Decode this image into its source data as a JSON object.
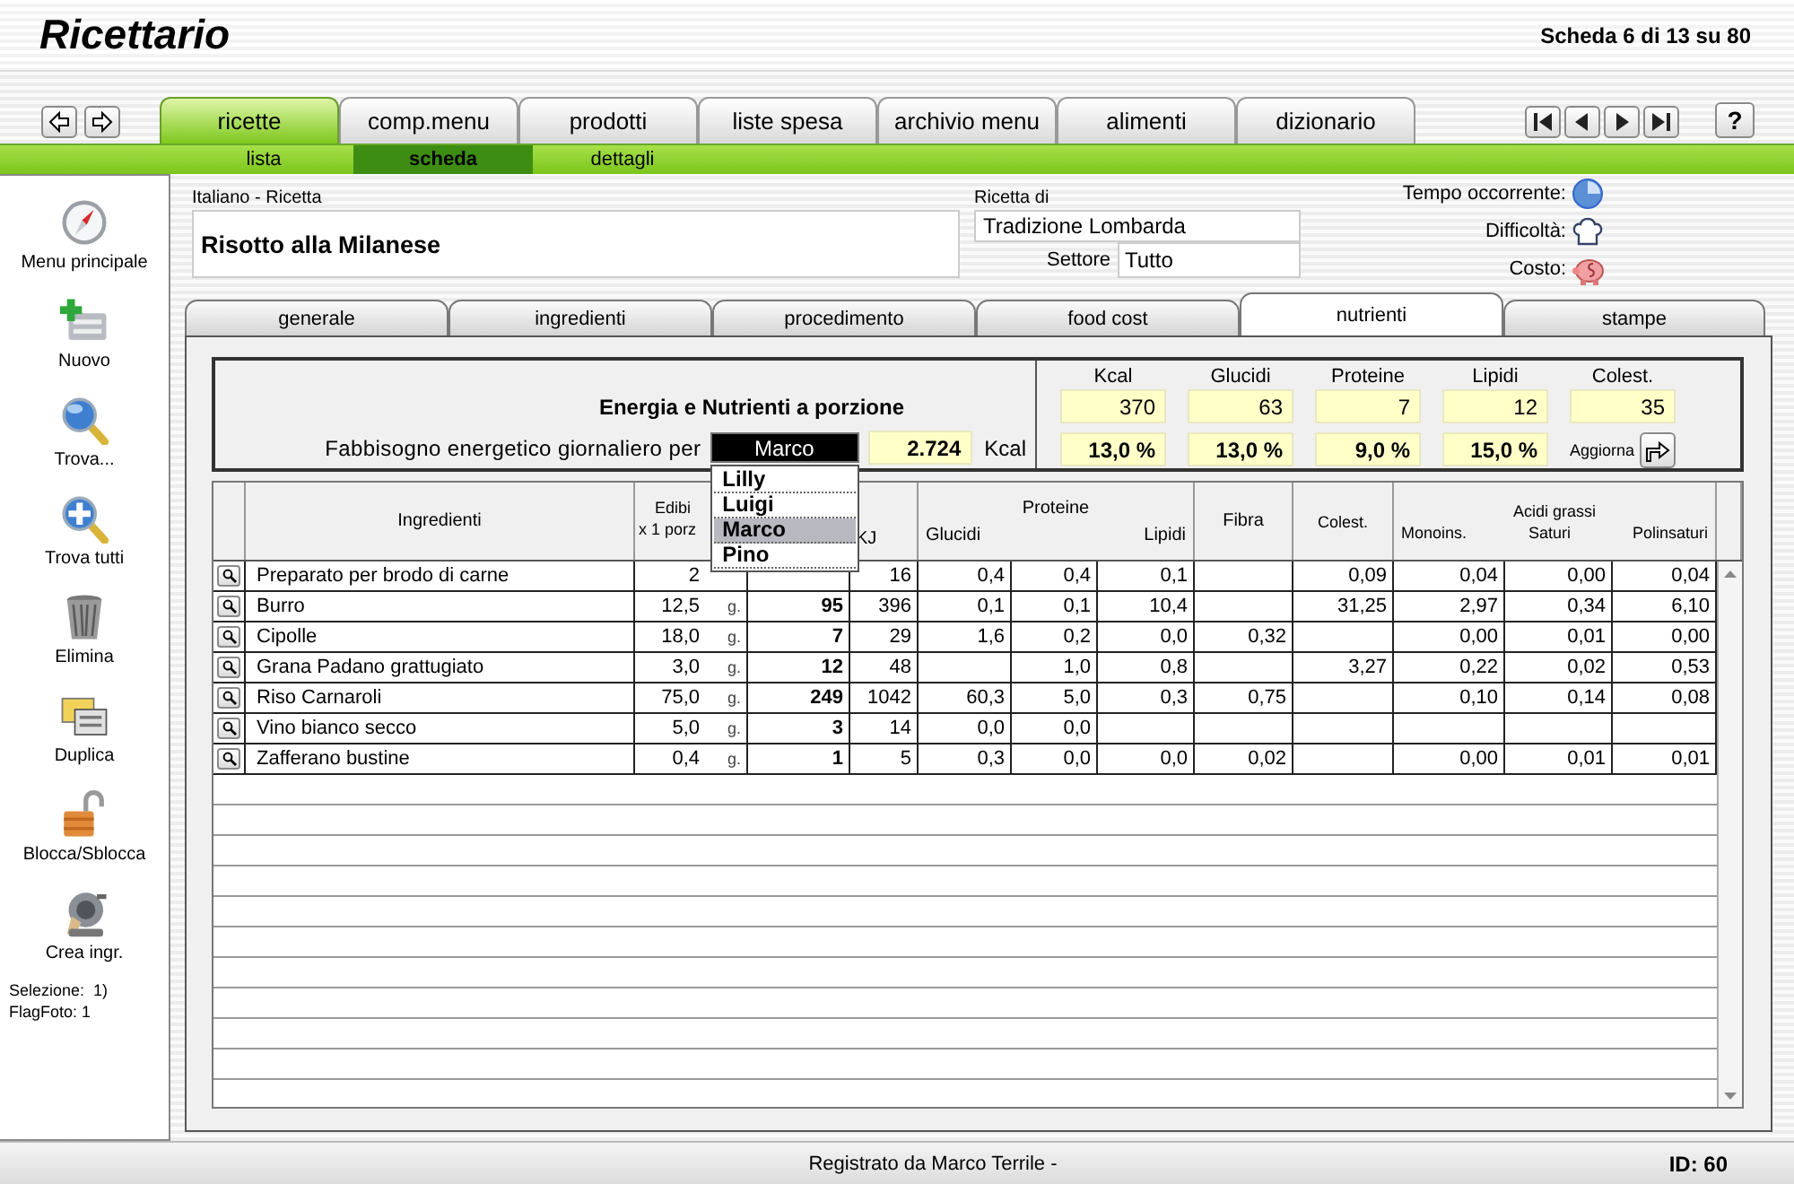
{
  "app_title": "Ricettario",
  "record_counter": "Scheda 6 di 13 su 80",
  "main_tabs": [
    {
      "label": "ricette",
      "selected": true
    },
    {
      "label": "comp.menu",
      "selected": false
    },
    {
      "label": "prodotti",
      "selected": false
    },
    {
      "label": "liste spesa",
      "selected": false
    },
    {
      "label": "archivio menu",
      "selected": false
    },
    {
      "label": "alimenti",
      "selected": false
    },
    {
      "label": "dizionario",
      "selected": false
    }
  ],
  "help_button": "?",
  "sub_tabs": [
    {
      "label": "lista",
      "selected": false
    },
    {
      "label": "scheda",
      "selected": true
    },
    {
      "label": "dettagli",
      "selected": false
    }
  ],
  "sidebar": {
    "items": [
      {
        "label": "Menu principale",
        "kind": "compass"
      },
      {
        "label": "Nuovo",
        "kind": "new"
      },
      {
        "label": "Trova...",
        "kind": "find"
      },
      {
        "label": "Trova tutti",
        "kind": "findall"
      },
      {
        "label": "Elimina",
        "kind": "delete"
      },
      {
        "label": "Duplica",
        "kind": "duplicate"
      },
      {
        "label": "Blocca/Sblocca",
        "kind": "lock"
      },
      {
        "label": "Crea ingr.",
        "kind": "grinder"
      }
    ],
    "selection": "Selezione:  1)",
    "flag_foto": "FlagFoto: 1"
  },
  "recipe": {
    "language_label": "Italiano - Ricetta",
    "name": "Risotto alla Milanese",
    "author_label": "Ricetta di",
    "author": "Tradizione Lombarda",
    "sector_label": "Settore",
    "sector": "Tutto",
    "time_label": "Tempo occorrente:",
    "difficulty_label": "Difficoltà:",
    "cost_label": "Costo:"
  },
  "section_tabs": [
    {
      "label": "generale",
      "selected": false
    },
    {
      "label": "ingredienti",
      "selected": false
    },
    {
      "label": "procedimento",
      "selected": false
    },
    {
      "label": "food cost",
      "selected": false
    },
    {
      "label": "nutrienti",
      "selected": true
    },
    {
      "label": "stampe",
      "selected": false
    }
  ],
  "energy": {
    "title": "Energia e Nutrienti a porzione",
    "requirement_label": "Fabbisogno energetico giornaliero per",
    "person": "Marco",
    "kcal_value": "2.724",
    "kcal_unit": "Kcal",
    "person_menu": [
      {
        "label": "Lilly",
        "selected": false
      },
      {
        "label": "Luigi",
        "selected": false
      },
      {
        "label": "Marco",
        "selected": true
      },
      {
        "label": "Pino",
        "selected": false
      }
    ],
    "nutrients": [
      {
        "label": "Kcal",
        "value": "370",
        "percent": "13,0 %"
      },
      {
        "label": "Glucidi",
        "value": "63",
        "percent": "13,0 %"
      },
      {
        "label": "Proteine",
        "value": "7",
        "percent": "9,0 %"
      },
      {
        "label": "Lipidi",
        "value": "12",
        "percent": "15,0 %"
      },
      {
        "label": "Colest.",
        "value": "35"
      }
    ],
    "refresh_label": "Aggiorna"
  },
  "table": {
    "headers": {
      "ingredients": "Ingredienti",
      "edible": "Edibi",
      "edible_sub": "x 1 porz",
      "kj": "KJ",
      "glucidi": "Glucidi",
      "proteine": "Proteine",
      "lipidi": "Lipidi",
      "fibra": "Fibra",
      "colest": "Colest.",
      "fatty_acids": "Acidi grassi",
      "mono": "Monoins.",
      "saturi": "Saturi",
      "poli": "Polinsaturi"
    },
    "rows": [
      {
        "name": "Preparato per brodo di carne",
        "amount": "2",
        "kj": "16",
        "glucidi": "0,4",
        "proteine": "0,4",
        "lipidi": "0,1",
        "colest": "0,09",
        "mono": "0,04",
        "saturi": "0,00",
        "poli": "0,04"
      },
      {
        "name": "Burro",
        "amount": "12,5",
        "unit": "g.",
        "kcal": "95",
        "kj": "396",
        "glucidi": "0,1",
        "proteine": "0,1",
        "lipidi": "10,4",
        "colest": "31,25",
        "mono": "2,97",
        "saturi": "0,34",
        "poli": "6,10"
      },
      {
        "name": "Cipolle",
        "amount": "18,0",
        "unit": "g.",
        "kcal": "7",
        "kj": "29",
        "glucidi": "1,6",
        "proteine": "0,2",
        "lipidi": "0,0",
        "fibra": "0,32",
        "mono": "0,00",
        "saturi": "0,01",
        "poli": "0,00"
      },
      {
        "name": "Grana Padano grattugiato",
        "amount": "3,0",
        "unit": "g.",
        "kcal": "12",
        "kj": "48",
        "proteine": "1,0",
        "lipidi": "0,8",
        "colest": "3,27",
        "mono": "0,22",
        "saturi": "0,02",
        "poli": "0,53"
      },
      {
        "name": "Riso Carnaroli",
        "amount": "75,0",
        "unit": "g.",
        "kcal": "249",
        "kj": "1042",
        "glucidi": "60,3",
        "proteine": "5,0",
        "lipidi": "0,3",
        "fibra": "0,75",
        "mono": "0,10",
        "saturi": "0,14",
        "poli": "0,08"
      },
      {
        "name": "Vino bianco secco",
        "amount": "5,0",
        "unit": "g.",
        "kcal": "3",
        "kj": "14",
        "glucidi": "0,0",
        "proteine": "0,0"
      },
      {
        "name": "Zafferano bustine",
        "amount": "0,4",
        "unit": "g.",
        "kcal": "1",
        "kj": "5",
        "glucidi": "0,3",
        "proteine": "0,0",
        "lipidi": "0,0",
        "fibra": "0,02",
        "mono": "0,00",
        "saturi": "0,01",
        "poli": "0,01"
      }
    ]
  },
  "status_bar": {
    "registered_by": "Registrato da Marco Terrile -",
    "id": "ID: 60"
  }
}
